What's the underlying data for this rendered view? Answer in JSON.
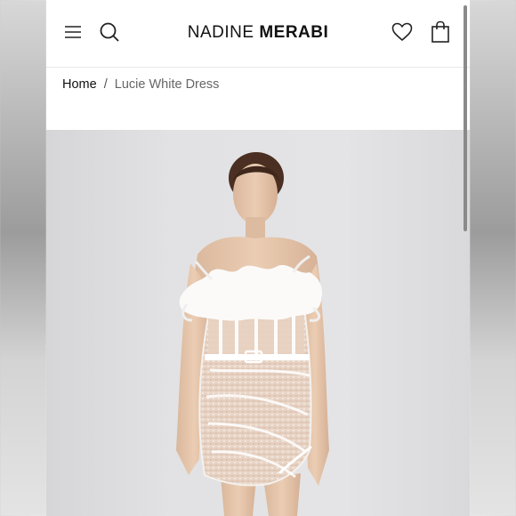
{
  "header": {
    "brand_light": "NADINE",
    "brand_bold": "MERABI"
  },
  "icons": {
    "menu": "hamburger-menu-icon",
    "search": "search-icon",
    "wishlist": "heart-icon",
    "bag": "shopping-bag-icon"
  },
  "breadcrumb": {
    "home": "Home",
    "separator": "/",
    "current": "Lucie White Dress"
  },
  "colors": {
    "text": "#111111",
    "breadcrumb_current": "#666666",
    "hero_bg": "#e2e2e4"
  }
}
